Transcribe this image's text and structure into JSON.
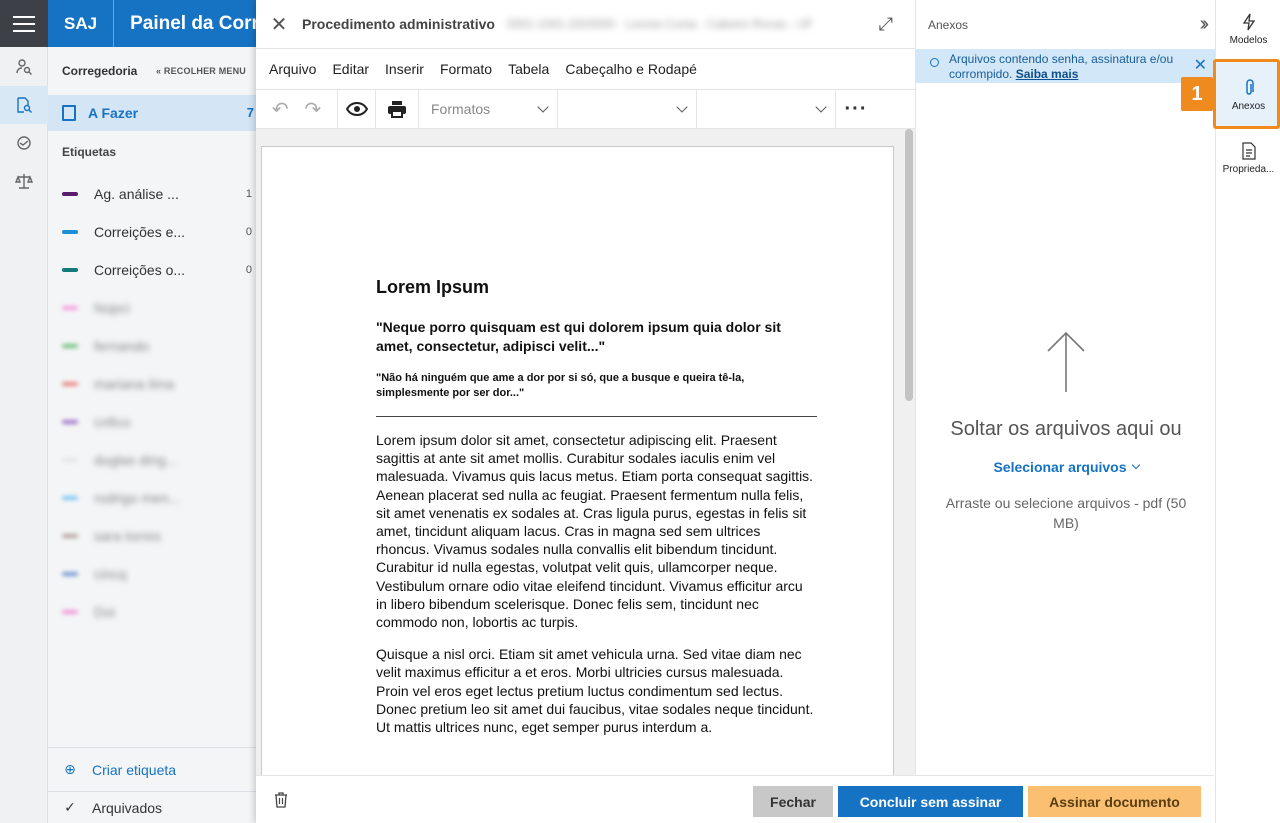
{
  "header": {
    "brand": "SAJ",
    "page_title": "Painel da Corregedoria"
  },
  "sidebar": {
    "section_title": "Corregedoria",
    "collapse_label": "« RECOLHER MENU",
    "todo": {
      "label": "A Fazer",
      "count": "7"
    },
    "labels_title": "Etiquetas",
    "tags": [
      {
        "name": "Ag. análise ...",
        "count": "1",
        "color": "#5b1a6e"
      },
      {
        "name": "Correições e...",
        "count": "0",
        "color": "#1b8fd6"
      },
      {
        "name": "Correições o...",
        "count": "0",
        "color": "#127a7a"
      },
      {
        "name": "Núpci",
        "count": "",
        "color": "#f27ad8"
      },
      {
        "name": "fernando",
        "count": "",
        "color": "#3da84a"
      },
      {
        "name": "mariana lima",
        "count": "",
        "color": "#e05656"
      },
      {
        "name": "cnfico",
        "count": "",
        "color": "#7b3fb5"
      },
      {
        "name": "duglas ding...",
        "count": "",
        "color": "#dddddd"
      },
      {
        "name": "rodrigo men...",
        "count": "",
        "color": "#4db3f0"
      },
      {
        "name": "sara torres",
        "count": "",
        "color": "#a08077"
      },
      {
        "name": "cincq",
        "count": "",
        "color": "#3a6fc4"
      },
      {
        "name": "Doi",
        "count": "",
        "color": "#f06cd0"
      }
    ],
    "create_label": "Criar etiqueta",
    "archived_label": "Arquivados"
  },
  "modal": {
    "title": "Procedimento administrativo",
    "title_redacted": "0001-1001-2020000 · Leonia Cunia - Cabeiro Rocas - UF",
    "menu": [
      "Arquivo",
      "Editar",
      "Inserir",
      "Formato",
      "Tabela",
      "Cabeçalho e Rodapé"
    ],
    "toolbar": {
      "formats_placeholder": "Formatos"
    },
    "document": {
      "heading": "Lorem Ipsum",
      "quote1": "\"Neque porro quisquam est qui dolorem ipsum quia dolor sit amet, consectetur, adipisci velit...\"",
      "quote2": "\"Não há ninguém que ame a dor por si só, que a busque e queira tê-la, simplesmente por ser dor...\"",
      "para1": "Lorem ipsum dolor sit amet, consectetur adipiscing elit. Praesent sagittis at ante sit amet mollis. Curabitur sodales iaculis enim vel malesuada. Vivamus quis lacus metus. Etiam porta consequat sagittis. Aenean placerat sed nulla ac feugiat. Praesent fermentum nulla felis, sit amet venenatis ex sodales at. Cras ligula purus, egestas in felis sit amet, tincidunt aliquam lacus. Cras in magna sed sem ultrices rhoncus. Vivamus sodales nulla convallis elit bibendum tincidunt. Curabitur id nulla egestas, volutpat velit quis, ullamcorper neque. Vestibulum ornare odio vitae eleifend tincidunt. Vivamus efficitur arcu in libero bibendum scelerisque. Donec felis sem, tincidunt nec commodo non, lobortis ac turpis.",
      "para2": "Quisque a nisl orci. Etiam sit amet vehicula urna. Sed vitae diam nec velit maximus efficitur a et eros. Morbi ultricies cursus malesuada. Proin vel eros eget lectus pretium luctus condimentum sed lectus. Donec pretium leo sit amet dui faucibus, vitae sodales neque tincidunt. Ut mattis ultrices nunc, eget semper purus interdum a."
    },
    "footer": {
      "close_label": "Fechar",
      "finish_label": "Concluir sem assinar",
      "sign_label": "Assinar documento"
    }
  },
  "attachments": {
    "title": "Anexos",
    "alert_text": "Arquivos contendo senha, assinatura e/ou corrompido.",
    "alert_link": "Saiba mais",
    "drop_text": "Soltar os arquivos aqui ou",
    "select_label": "Selecionar arquivos",
    "hint": "Arraste ou selecione arquivos - pdf (50 MB)"
  },
  "right_rail": {
    "items": [
      {
        "label": "Modelos",
        "icon": "lightning-icon"
      },
      {
        "label": "Anexos",
        "icon": "paperclip-icon"
      },
      {
        "label": "Proprieda...",
        "icon": "document-icon"
      }
    ],
    "callout_number": "1"
  },
  "colors": {
    "primary": "#1673c4",
    "accent": "#f08a1c",
    "sign_button": "#fbbf72"
  }
}
